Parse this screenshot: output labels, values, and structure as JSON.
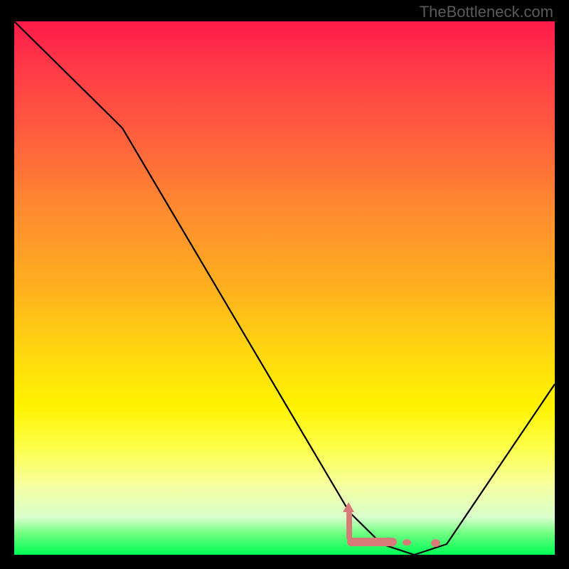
{
  "watermark": "TheBottleneck.com",
  "chart_data": {
    "type": "line",
    "title": "",
    "xlabel": "",
    "ylabel": "",
    "xlim": [
      0,
      100
    ],
    "ylim": [
      0,
      100
    ],
    "series": [
      {
        "name": "bottleneck-curve",
        "x": [
          0,
          20,
          62,
          68,
          74,
          80,
          100
        ],
        "values": [
          100,
          80,
          8,
          2,
          0,
          2,
          32
        ]
      }
    ],
    "markers": [
      {
        "name": "pointer-arrow",
        "x": 62,
        "y": 8,
        "shape": "arrow-up"
      },
      {
        "name": "flat-segment",
        "x_start": 62,
        "x_end": 71,
        "y": 1.5,
        "shape": "bar"
      },
      {
        "name": "dot-1",
        "x": 73,
        "y": 1.2,
        "shape": "dot"
      },
      {
        "name": "dot-2",
        "x": 78,
        "y": 1.0,
        "shape": "dot"
      }
    ],
    "background_gradient": {
      "stops": [
        {
          "pos": 0.0,
          "color": "#ff1a4a"
        },
        {
          "pos": 0.5,
          "color": "#ffb01e"
        },
        {
          "pos": 0.8,
          "color": "#fdff4a"
        },
        {
          "pos": 1.0,
          "color": "#00ff55"
        }
      ]
    },
    "colors": {
      "curve": "#000000",
      "marker": "#d87a78"
    }
  }
}
